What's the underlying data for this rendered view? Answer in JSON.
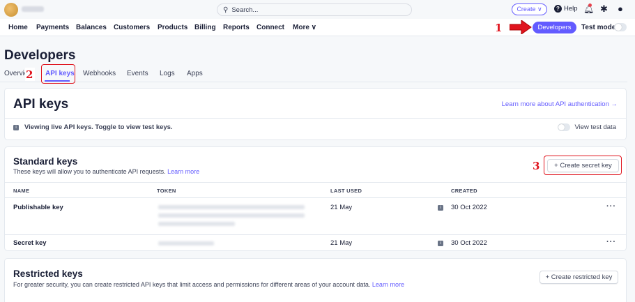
{
  "topbar": {
    "search_placeholder": "Search...",
    "create_label": "Create ∨",
    "help_label": "Help"
  },
  "nav": {
    "items": [
      "Home",
      "Payments",
      "Balances",
      "Customers",
      "Products",
      "Billing",
      "Reports",
      "Connect",
      "More ∨"
    ],
    "developers_label": "Developers",
    "test_mode_label": "Test mode"
  },
  "annotations": [
    "1",
    "2",
    "3"
  ],
  "page": {
    "title": "Developers",
    "tabs": [
      "Overview",
      "API keys",
      "Webhooks",
      "Events",
      "Logs",
      "Apps"
    ],
    "active_tab": "API keys"
  },
  "api_keys_card": {
    "title": "API keys",
    "learn_link": "Learn more about API authentication →",
    "live_notice": "Viewing live API keys. Toggle to view test keys.",
    "view_test_label": "View test data"
  },
  "standard_keys": {
    "title": "Standard keys",
    "subtitle": "These keys will allow you to authenticate API requests.",
    "learn_more": "Learn more",
    "create_button": "+ Create secret key",
    "columns": [
      "NAME",
      "TOKEN",
      "LAST USED",
      "CREATED"
    ],
    "rows": [
      {
        "name": "Publishable key",
        "last_used": "21 May",
        "created": "30 Oct 2022",
        "menu": "···"
      },
      {
        "name": "Secret key",
        "last_used": "21 May",
        "created": "30 Oct 2022",
        "menu": "···"
      }
    ]
  },
  "restricted_keys": {
    "title": "Restricted keys",
    "subtitle": "For greater security, you can create restricted API keys that limit access and permissions for different areas of your account data.",
    "learn_more": "Learn more",
    "create_button": "+ Create restricted key"
  },
  "colors": {
    "accent": "#635bff",
    "annotation": "#e0141e"
  }
}
